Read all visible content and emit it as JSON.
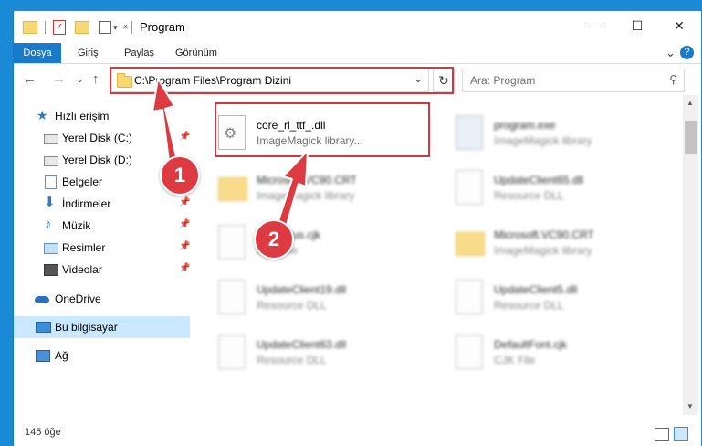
{
  "window": {
    "title": "Program",
    "controls": {
      "minimize": "—",
      "maximize": "☐",
      "close": "✕"
    }
  },
  "ribbon": {
    "tabs": [
      "Dosya",
      "Giriş",
      "Paylaş",
      "Görünüm"
    ],
    "chevron": "⌄",
    "help": "?"
  },
  "navigation": {
    "back": "←",
    "forward": "→",
    "recent": "⌄",
    "up": "↑",
    "address": "C:\\Program Files\\Program Dizini",
    "dropdown": "⌄",
    "refresh": "↻",
    "search_placeholder": "Ara: Program",
    "search_icon": "⚲"
  },
  "sidebar": {
    "quick_access": "Hızlı erişim",
    "items": [
      {
        "label": "Yerel Disk (C:)",
        "icon": "disk-c-icon",
        "pinned": true
      },
      {
        "label": "Yerel Disk (D:)",
        "icon": "disk-d-icon",
        "pinned": false
      },
      {
        "label": "Belgeler",
        "icon": "documents-icon",
        "pinned": true
      },
      {
        "label": "İndirmeler",
        "icon": "downloads-icon",
        "pinned": true
      },
      {
        "label": "Müzik",
        "icon": "music-icon",
        "pinned": true
      },
      {
        "label": "Resimler",
        "icon": "pictures-icon",
        "pinned": true
      },
      {
        "label": "Videolar",
        "icon": "videos-icon",
        "pinned": true
      }
    ],
    "onedrive": "OneDrive",
    "this_pc": "Bu bilgisayar",
    "network": "Ağ",
    "pin_glyph": "📌"
  },
  "files": [
    {
      "name": "core_rl_ttf_.dll",
      "desc": "ImageMagick library...",
      "icon": "dll-icon"
    },
    {
      "name": "program.exe",
      "desc": "ImageMagick library",
      "icon": "exe-icon"
    },
    {
      "name": "Microsoft.VC90.CRT",
      "desc": "ImageMagick library",
      "icon": "folder-icon"
    },
    {
      "name": "UpdateClient65.dll",
      "desc": "Resource DLL",
      "icon": "dll-icon"
    },
    {
      "name": "Exitstatus.cjk",
      "desc": "CJK File",
      "icon": "file-icon"
    },
    {
      "name": "Microsoft.VC90.CRT",
      "desc": "ImageMagick library",
      "icon": "folder-icon"
    },
    {
      "name": "UpdateClient19.dll",
      "desc": "Resource DLL",
      "icon": "dll-icon"
    },
    {
      "name": "UpdateClient5.dll",
      "desc": "Resource DLL",
      "icon": "dll-icon"
    },
    {
      "name": "UpdateClient63.dll",
      "desc": "Resource DLL",
      "icon": "dll-icon"
    },
    {
      "name": "DefaultFont.cjk",
      "desc": "CJK File",
      "icon": "file-icon"
    }
  ],
  "status": {
    "count": "145 öğe"
  },
  "annotations": {
    "step1": "1",
    "step2": "2"
  },
  "colors": {
    "accent": "#1979ca",
    "annotation": "#dd3b41",
    "selection": "#cce8ff"
  }
}
